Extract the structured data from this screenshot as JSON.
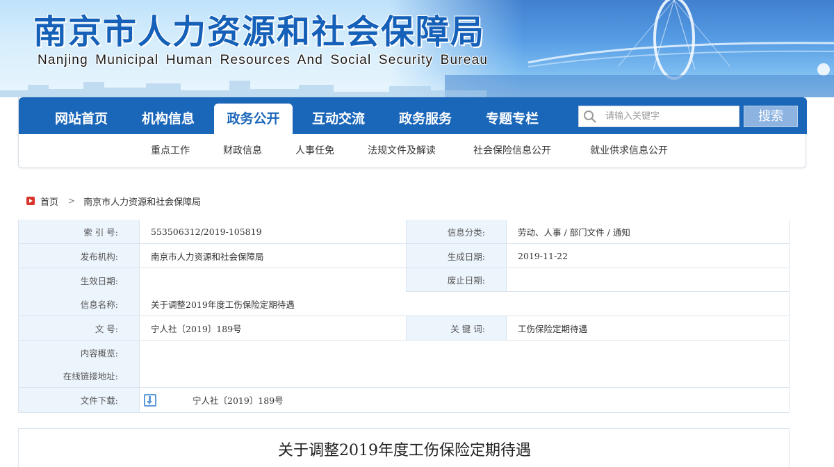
{
  "header": {
    "title_cn": "南京市人力资源和社会保障局",
    "title_en": "Nanjing Municipal Human Resources And Social Security Bureau"
  },
  "nav": {
    "items": [
      {
        "label": "网站首页"
      },
      {
        "label": "机构信息"
      },
      {
        "label": "政务公开"
      },
      {
        "label": "互动交流"
      },
      {
        "label": "政务服务"
      },
      {
        "label": "专题专栏"
      }
    ],
    "active": "政务公开",
    "search_placeholder": "请输入关键字",
    "search_button": "搜索",
    "sub_items": [
      {
        "label": "重点工作"
      },
      {
        "label": "财政信息"
      },
      {
        "label": "人事任免"
      },
      {
        "label": "法规文件及解读"
      },
      {
        "label": "社会保险信息公开"
      },
      {
        "label": "就业供求信息公开"
      }
    ]
  },
  "breadcrumb": {
    "home": "首页",
    "separator": ">",
    "current": "南京市人力资源和社会保障局"
  },
  "info": {
    "index_label": "索 引 号:",
    "index_value": "553506312/2019-105819",
    "category_label": "信息分类:",
    "category_value": "劳动、人事 / 部门文件 / 通知",
    "publisher_label": "发布机构:",
    "publisher_value": "南京市人力资源和社会保障局",
    "created_label": "生成日期:",
    "created_value": "2019-11-22",
    "effective_label": "生效日期:",
    "effective_value": "",
    "expiry_label": "废止日期:",
    "expiry_value": "",
    "name_label": "信息名称:",
    "name_value": "关于调整2019年度工伤保险定期待遇",
    "doc_no_label": "文    号:",
    "doc_no_value": "宁人社〔2019〕189号",
    "keywords_label": "关 键 词:",
    "keywords_value": "工伤保险定期待遇",
    "summary_label": "内容概览:",
    "online_label": "在线链接地址:",
    "download_label": "文件下载:",
    "download_value": "宁人社〔2019〕189号"
  },
  "article": {
    "title": "关于调整2019年度工伤保险定期待遇"
  },
  "colors": {
    "nav_blue": "#1a66b9",
    "title_blue": "#1560b8",
    "label_bg": "#edf5fc",
    "search_button": "#8db3e0",
    "home_icon": "#d9342b"
  }
}
